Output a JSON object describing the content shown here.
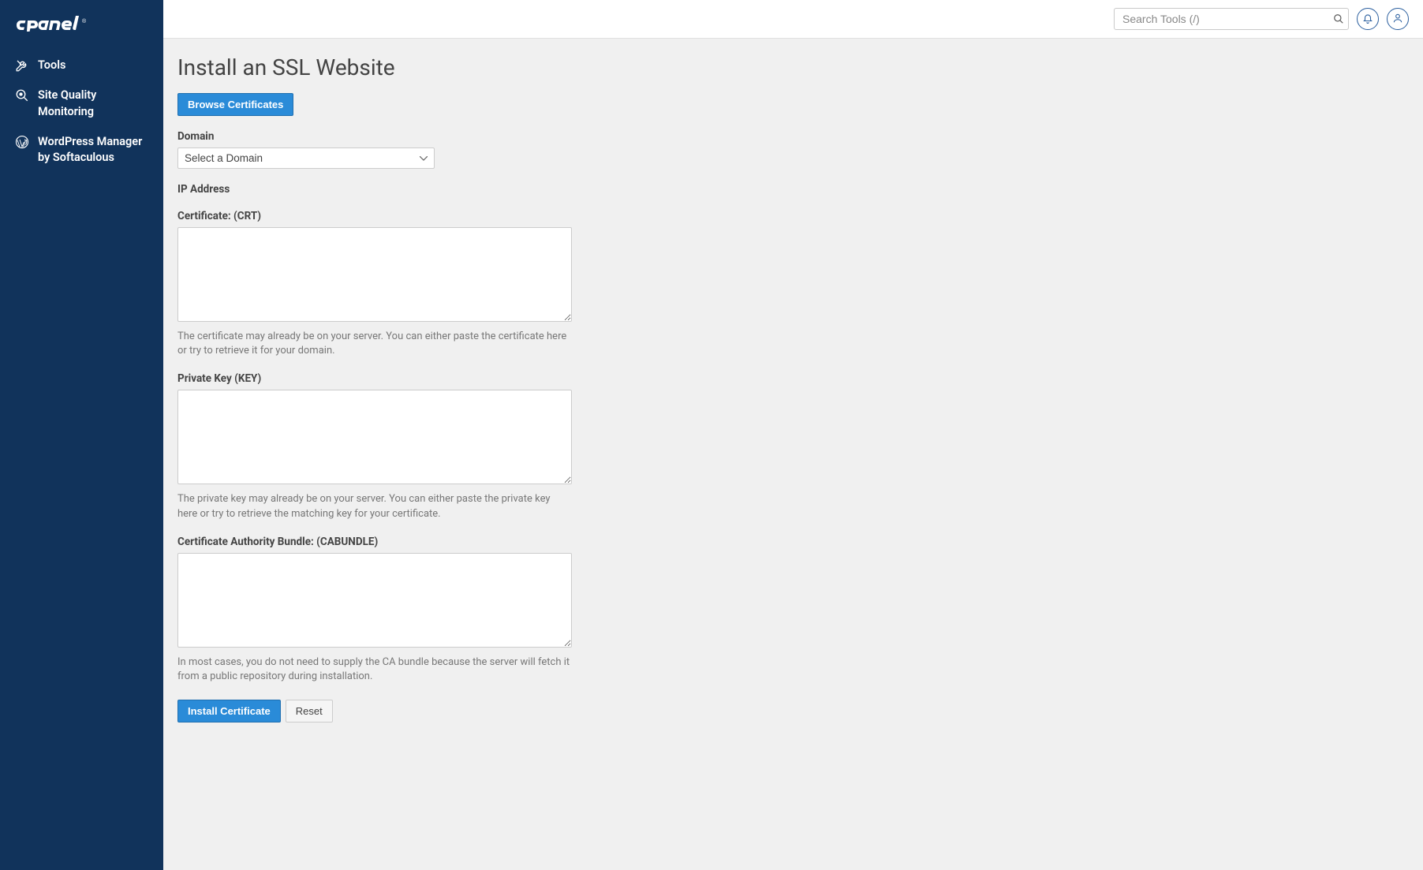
{
  "sidebar": {
    "items": [
      {
        "label": "Tools"
      },
      {
        "label": "Site Quality Monitoring"
      },
      {
        "label": "WordPress Manager by Softaculous"
      }
    ]
  },
  "header": {
    "search_placeholder": "Search Tools (/)"
  },
  "page": {
    "title": "Install an SSL Website",
    "browse_btn": "Browse Certificates",
    "domain": {
      "label": "Domain",
      "placeholder": "Select a Domain"
    },
    "ip": {
      "label": "IP Address",
      "value": " "
    },
    "crt": {
      "label": "Certificate: (CRT)",
      "help": "The certificate may already be on your server. You can either paste the certificate here or try to retrieve it for your domain."
    },
    "key": {
      "label": "Private Key (KEY)",
      "help": "The private key may already be on your server. You can either paste the private key here or try to retrieve the matching key for your certificate."
    },
    "cabundle": {
      "label": "Certificate Authority Bundle: (CABUNDLE)",
      "help": "In most cases, you do not need to supply the CA bundle because the server will fetch it from a public repository during installation."
    },
    "install_btn": "Install Certificate",
    "reset_btn": "Reset"
  }
}
